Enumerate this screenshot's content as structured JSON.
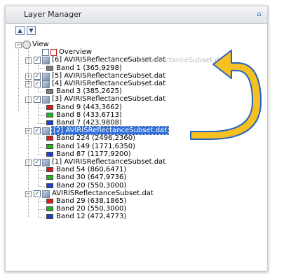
{
  "panel": {
    "title": "Layer Manager",
    "pin_icon": "pin-icon"
  },
  "tree": {
    "root_label": "View",
    "overview_label": "Overview",
    "layers": [
      {
        "label": "[6] AVIRISReflectanceSubset.dat",
        "ghost": "AVIRISReflectanceSubset.dat",
        "checked": true,
        "bands": [
          {
            "label": "Band 1 (365,9298)",
            "color": "gray"
          }
        ]
      },
      {
        "label": "[5] AVIRISReflectanceSubset.dat",
        "checked": true,
        "collapsed": true,
        "bands": []
      },
      {
        "label": "[4] AVIRISReflectanceSubset.dat",
        "checked": true,
        "bands": [
          {
            "label": "Band 3 (385,2625)",
            "color": "gray"
          }
        ]
      },
      {
        "label": "[3] AVIRISReflectanceSubset.dat",
        "checked": true,
        "bands": [
          {
            "label": "Band 9 (443,3662)",
            "color": "red"
          },
          {
            "label": "Band 8 (433,6713)",
            "color": "green"
          },
          {
            "label": "Band 7 (423,9808)",
            "color": "blue"
          }
        ]
      },
      {
        "label": "[2] AVIRISReflectanceSubset.dat",
        "checked": true,
        "selected": true,
        "bands": [
          {
            "label": "Band 224 (2496,2360)",
            "color": "red"
          },
          {
            "label": "Band 149 (1771,6350)",
            "color": "green"
          },
          {
            "label": "Band 87 (1177,9200)",
            "color": "blue"
          }
        ]
      },
      {
        "label": "[1] AVIRISReflectanceSubset.dat",
        "checked": true,
        "bands": [
          {
            "label": "Band 54 (860,6471)",
            "color": "red"
          },
          {
            "label": "Band 30 (647,9736)",
            "color": "green"
          },
          {
            "label": "Band 20 (550,3000)",
            "color": "blue"
          }
        ]
      },
      {
        "label": "AVIRISReflectanceSubset.dat",
        "checked": true,
        "bands": [
          {
            "label": "Band 29 (638,1865)",
            "color": "red"
          },
          {
            "label": "Band 20 (550,3000)",
            "color": "green"
          },
          {
            "label": "Band 12 (472,4773)",
            "color": "blue"
          }
        ]
      }
    ]
  },
  "colors": {
    "selection": "#2f6ed8",
    "arrow_fill": "#f5c020",
    "arrow_stroke": "#2563c4",
    "band_red": "#d41c1c",
    "band_green": "#22b422",
    "band_blue": "#1f3fd0",
    "band_gray": "#7c7c7c"
  }
}
